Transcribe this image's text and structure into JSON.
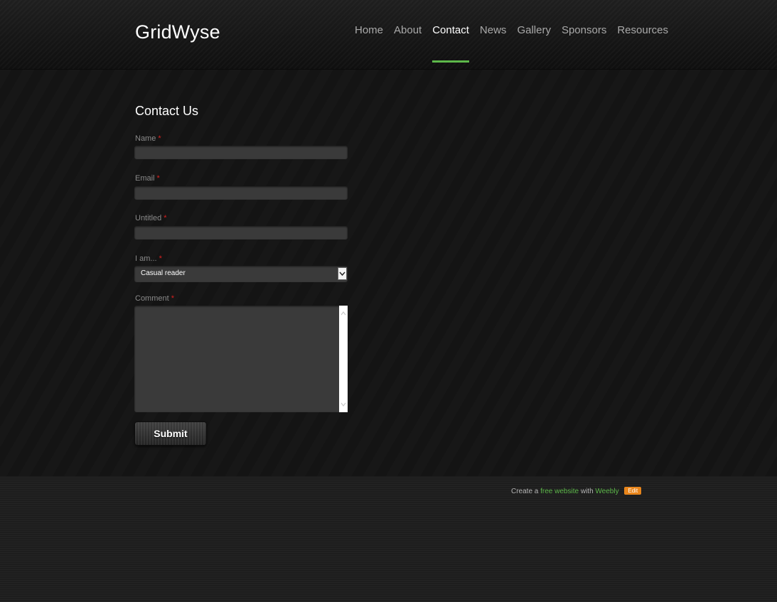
{
  "site": {
    "logo": "GridWyse"
  },
  "nav": {
    "items": [
      {
        "label": "Home"
      },
      {
        "label": "About"
      },
      {
        "label": "Contact"
      },
      {
        "label": "News"
      },
      {
        "label": "Gallery"
      },
      {
        "label": "Sponsors"
      },
      {
        "label": "Resources"
      }
    ],
    "active": "Contact",
    "accent_color": "#5db84a"
  },
  "form": {
    "title": "Contact Us",
    "required_marker": "*",
    "fields": {
      "name": {
        "label": "Name",
        "value": ""
      },
      "email": {
        "label": "Email",
        "value": ""
      },
      "untitled": {
        "label": "Untitled",
        "value": ""
      },
      "iam": {
        "label": "I am...",
        "selected": "Casual reader"
      },
      "comment": {
        "label": "Comment",
        "value": ""
      }
    },
    "submit_label": "Submit"
  },
  "footer": {
    "prefix": "Create a",
    "link1": "free website",
    "middle": "with",
    "link2": "Weebly",
    "edit": "Edit",
    "edit_color": "#e8851b"
  }
}
